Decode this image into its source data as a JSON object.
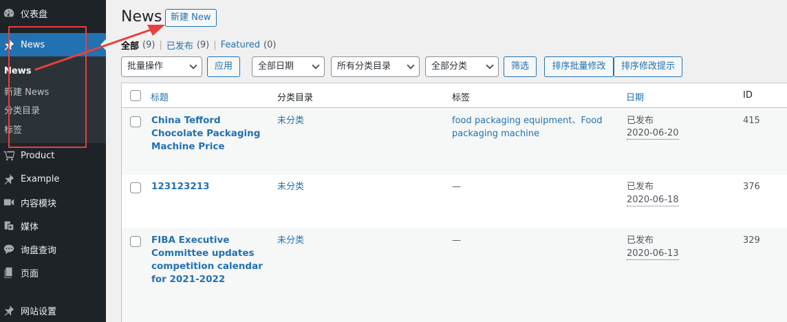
{
  "sidebar": {
    "items": [
      {
        "label": "仪表盘",
        "icon": "dashboard-icon"
      },
      {
        "label": "News",
        "icon": "pin-icon"
      },
      {
        "label": "Product",
        "icon": "cart-icon"
      },
      {
        "label": "Example",
        "icon": "pin-icon"
      },
      {
        "label": "内容模块",
        "icon": "video-icon"
      },
      {
        "label": "媒体",
        "icon": "media-icon"
      },
      {
        "label": "询盘查询",
        "icon": "comment-icon"
      },
      {
        "label": "页面",
        "icon": "page-icon"
      },
      {
        "label": "网站设置",
        "icon": "plugin-icon"
      }
    ],
    "submenu": [
      {
        "label": "News"
      },
      {
        "label": "新建 News"
      },
      {
        "label": "分类目录"
      },
      {
        "label": "标签"
      }
    ]
  },
  "header": {
    "title": "News",
    "add_new": "新建 New"
  },
  "filters": {
    "all": "全部",
    "all_count": "(9)",
    "published": "已发布",
    "published_count": "(9)",
    "featured": "Featured",
    "featured_count": "(0)",
    "sep": "|"
  },
  "tablenav": {
    "bulk_action": "批量操作",
    "apply": "应用",
    "all_dates": "全部日期",
    "all_categories": "所有分类目录",
    "all_types": "全部分类",
    "filter": "筛选",
    "sort_bulk": "排序批量修改",
    "sort_tip": "排序修改提示"
  },
  "table": {
    "columns": [
      "标题",
      "分类目录",
      "标签",
      "日期",
      "ID"
    ],
    "rows": [
      {
        "title": "China Tefford Chocolate Packaging Machine Price",
        "category": "未分类",
        "tags": "food packaging equipment、Food packaging machine",
        "status": "已发布",
        "date": "2020-06-20",
        "id": "415"
      },
      {
        "title": "123123213",
        "category": "未分类",
        "tags": "—",
        "status": "已发布",
        "date": "2020-06-18",
        "id": "376"
      },
      {
        "title": "FIBA Executive Committee updates competition calendar for 2021-2022",
        "category": "未分类",
        "tags": "—",
        "status": "已发布",
        "date": "2020-06-13",
        "id": "329"
      }
    ]
  },
  "colors": {
    "sidebar_bg": "#1d2327",
    "accent": "#2271b1",
    "annotation": "#e8403d"
  }
}
